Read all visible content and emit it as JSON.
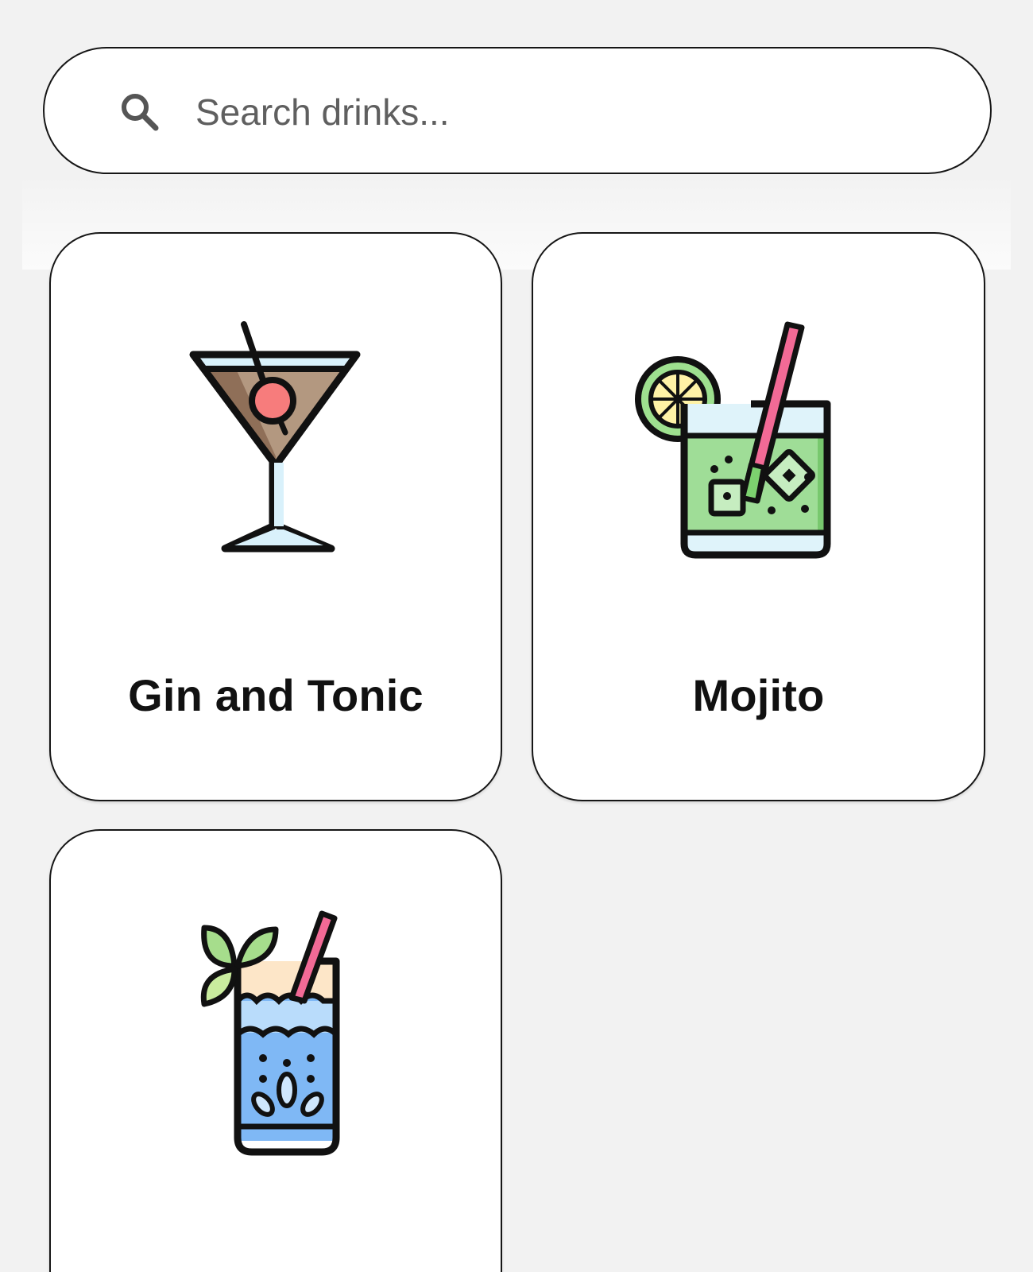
{
  "search": {
    "placeholder": "Search drinks...",
    "value": ""
  },
  "drinks": [
    {
      "name": "Gin and Tonic",
      "icon": "martini-glass-icon"
    },
    {
      "name": "Mojito",
      "icon": "mojito-glass-icon"
    },
    {
      "name": "",
      "icon": "tall-cocktail-glass-icon"
    }
  ],
  "colors": {
    "background": "#f2f2f2",
    "card": "#ffffff",
    "border": "#161616",
    "text": "#111111",
    "placeholder": "#5f5f5f"
  }
}
